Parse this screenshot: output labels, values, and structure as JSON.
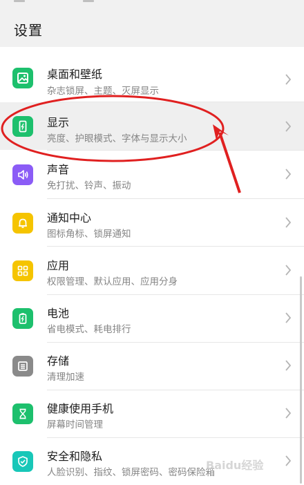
{
  "header": {
    "title": "设置"
  },
  "settings": [
    {
      "title": "桌面和壁纸",
      "subtitle": "杂志锁屏、主题、灭屏显示",
      "icon": "wallpaper-icon",
      "color": "#1dc06d"
    },
    {
      "title": "显示",
      "subtitle": "亮度、护眼模式、字体与显示大小",
      "icon": "display-icon",
      "color": "#1dc06d"
    },
    {
      "title": "声音",
      "subtitle": "免打扰、铃声、振动",
      "icon": "sound-icon",
      "color": "#8b5cf6"
    },
    {
      "title": "通知中心",
      "subtitle": "图标角标、锁屏通知",
      "icon": "bell-icon",
      "color": "#f5c400"
    },
    {
      "title": "应用",
      "subtitle": "权限管理、默认应用、应用分身",
      "icon": "apps-icon",
      "color": "#f5c400"
    },
    {
      "title": "电池",
      "subtitle": "省电模式、耗电排行",
      "icon": "battery-icon",
      "color": "#1dc06d"
    },
    {
      "title": "存储",
      "subtitle": "清理加速",
      "icon": "storage-icon",
      "color": "#8a8a8a"
    },
    {
      "title": "健康使用手机",
      "subtitle": "屏幕时间管理",
      "icon": "hourglass-icon",
      "color": "#1dc06d"
    },
    {
      "title": "安全和隐私",
      "subtitle": "人脸识别、指纹、锁屏密码、密码保险箱",
      "icon": "shield-icon",
      "color": "#18c7b8"
    }
  ],
  "annotation": {
    "color": "#e02020"
  },
  "watermark": {
    "text": "Baidu经验"
  }
}
